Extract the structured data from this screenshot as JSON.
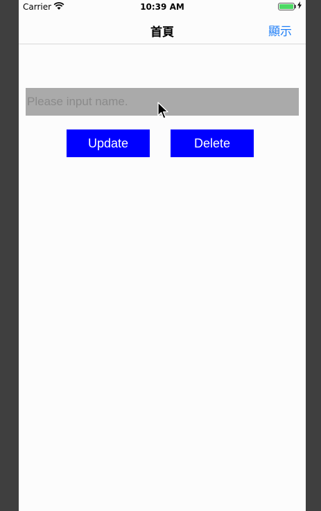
{
  "status_bar": {
    "carrier": "Carrier",
    "time": "10:39 AM",
    "wifi_icon": "wifi-icon",
    "battery_icon": "battery-icon",
    "charging_icon": "charging-bolt-icon",
    "battery_color": "#4cd964"
  },
  "nav": {
    "title": "首頁",
    "right_button": "顯示",
    "tint_color": "#1e7ef7"
  },
  "form": {
    "name_value": "",
    "name_placeholder": "Please input name.",
    "update_label": "Update",
    "delete_label": "Delete",
    "button_color": "#0000ff"
  },
  "cursor_icon": "arrow-pointer-icon"
}
